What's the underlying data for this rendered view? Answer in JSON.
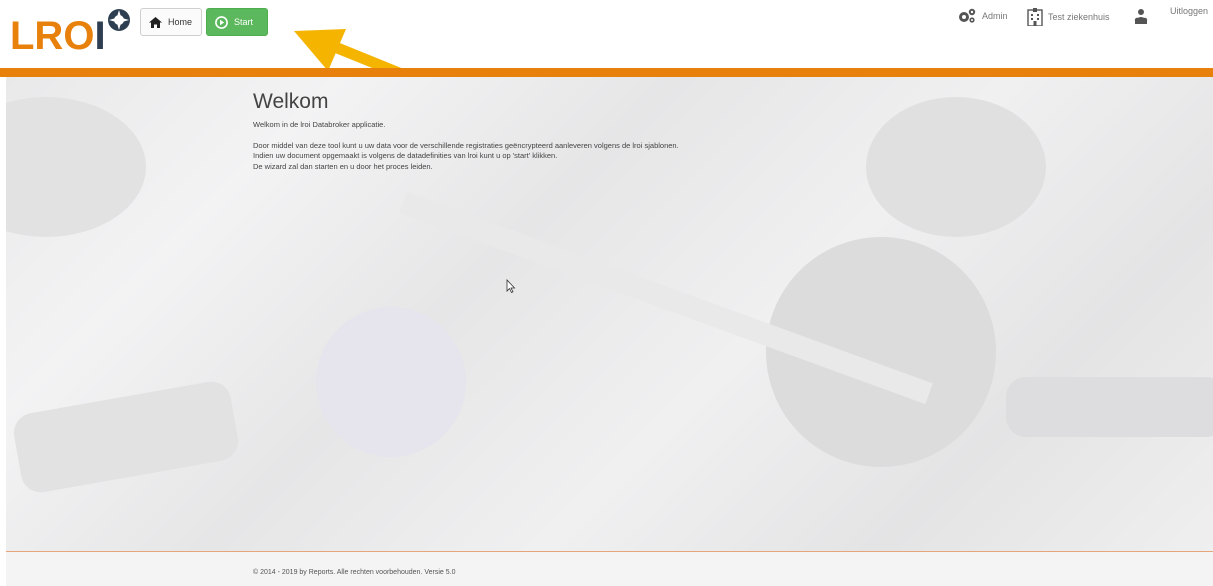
{
  "header": {
    "logo_text": "LRO",
    "logo_letter_i": "I",
    "home_label": "Home",
    "start_label": "Start",
    "nav": {
      "admin_label": "Admin",
      "hospital_label": "Test ziekenhuis",
      "logout_label": "Uitloggen"
    }
  },
  "main": {
    "title": "Welkom",
    "intro": "Welkom in de lroi Databroker applicatie.",
    "lines": [
      "Door middel van deze tool kunt u uw data voor de verschillende registraties geëncrypteerd aanleveren volgens de lroi sjablonen.",
      "Indien uw document opgemaakt is volgens de datadefinities van lroi kunt u op 'start' klikken.",
      "De wizard zal dan starten en u door het proces leiden."
    ]
  },
  "footer": {
    "text": "© 2014 - 2019 by Reports. Alle rechten voorbehouden. Versie 5.0"
  },
  "colors": {
    "accent": "#e8800c",
    "start_green": "#5cb85c",
    "logo_dark": "#2d3e50",
    "arrow": "#f4b400"
  }
}
